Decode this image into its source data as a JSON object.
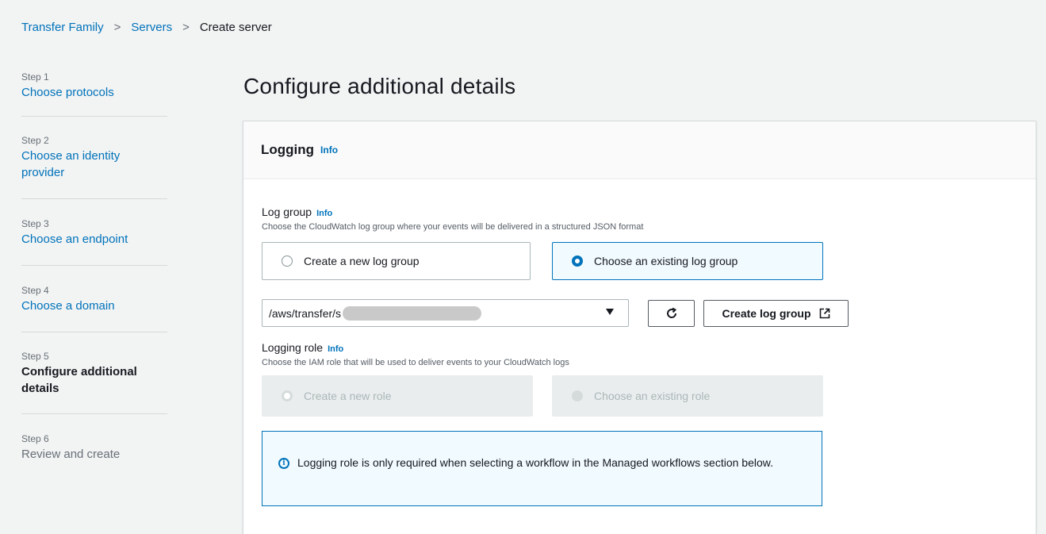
{
  "breadcrumb": {
    "items": [
      "Transfer Family",
      "Servers"
    ],
    "current": "Create server",
    "separator": ">"
  },
  "steps": [
    {
      "num": "Step 1",
      "title": "Choose protocols",
      "state": "link"
    },
    {
      "num": "Step 2",
      "title": "Choose an identity provider",
      "state": "link"
    },
    {
      "num": "Step 3",
      "title": "Choose an endpoint",
      "state": "link"
    },
    {
      "num": "Step 4",
      "title": "Choose a domain",
      "state": "link"
    },
    {
      "num": "Step 5",
      "title": "Configure additional details",
      "state": "active"
    },
    {
      "num": "Step 6",
      "title": "Review and create",
      "state": "disabled"
    }
  ],
  "page": {
    "title": "Configure additional details"
  },
  "logging": {
    "header": "Logging",
    "info": "Info",
    "log_group": {
      "label": "Log group",
      "info": "Info",
      "description": "Choose the CloudWatch log group where your events will be delivered in a structured JSON format",
      "options": [
        "Create a new log group",
        "Choose an existing log group"
      ],
      "selected": "Choose an existing log group",
      "select_value": "/aws/transfer/s",
      "refresh_icon": "refresh-icon",
      "create_button": "Create log group",
      "external_icon": "external-link-icon"
    },
    "logging_role": {
      "label": "Logging role",
      "info": "Info",
      "description": "Choose the IAM role that will be used to deliver events to your CloudWatch logs",
      "options": [
        "Create a new role",
        "Choose an existing role"
      ]
    },
    "alert": {
      "icon": "info-circle-icon",
      "text": "Logging role is only required when selecting a workflow in the Managed workflows section below."
    }
  },
  "colors": {
    "link": "#0073bb",
    "background": "#f2f3f3",
    "selected_tile": "#f1faff",
    "disabled_tile": "#eaeded"
  }
}
